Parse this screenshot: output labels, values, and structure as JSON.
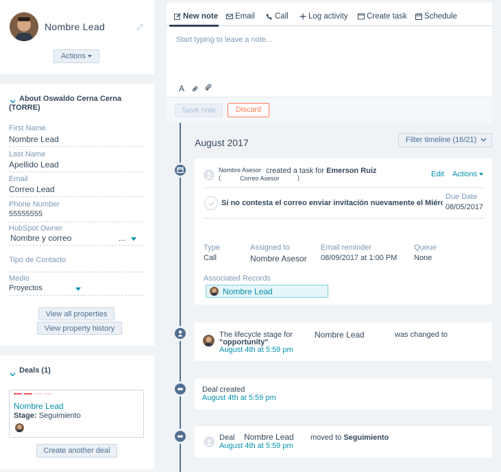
{
  "profile": {
    "name": "Nombre Lead",
    "actions_label": "Actions"
  },
  "about": {
    "title": "About Oswaldo Cerna Cerna (TORRE)",
    "fields": [
      {
        "label": "First Name",
        "value": "Nombre Lead"
      },
      {
        "label": "Last Name",
        "value": "Apellido Lead"
      },
      {
        "label": "Email",
        "value": "Correo Lead"
      },
      {
        "label": "Phone Number",
        "value": "55555555"
      },
      {
        "label": "HubSpot Owner",
        "value": "Nombre y correo",
        "suffix": "..."
      },
      {
        "label": "Tipo de Contacto",
        "value": ""
      },
      {
        "label": "Medio",
        "value": "Proyectos"
      }
    ],
    "view_all_label": "View all properties",
    "view_history_label": "View property history"
  },
  "deals": {
    "title": "Deals (1)",
    "deal_name": "Nombre Lead",
    "stage_label": "Stage:",
    "stage_value": "Seguimiento",
    "create_label": "Create another deal"
  },
  "composer": {
    "tabs": [
      "New note",
      "Email",
      "Call",
      "Log activity",
      "Create task",
      "Schedule"
    ],
    "placeholder": "Start typing to leave a note...",
    "save_label": "Save note",
    "discard_label": "Discard"
  },
  "timeline": {
    "month": "August 2017",
    "filter_label": "Filter timeline (16/21)",
    "task": {
      "actor": "Nombre Asesor",
      "actor_email": "Correo Asesor",
      "paren_open": "(",
      "paren_close": ")",
      "action": "created a task for",
      "target": "Emerson Ruiz",
      "edit_label": "Edit",
      "actions_label": "Actions",
      "task_title": "Si no contesta el correo enviar invitación nuevamente el Miérc...",
      "due_label": "Due Date",
      "due_value": "08/05/2017",
      "type_label": "Type",
      "type_value": "Call",
      "assigned_label": "Assigned to",
      "assigned_value": "Nombre Asesor",
      "reminder_label": "Email reminder",
      "reminder_value": "08/09/2017 at 1:00 PM",
      "queue_label": "Queue",
      "queue_value": "None",
      "assoc_label": "Associated Records",
      "assoc_value": "Nombre Lead"
    },
    "lifecycle": {
      "text1": "The lifecycle stage for",
      "name": "Nombre Lead",
      "text2": "was changed to",
      "stage": "\"opportunity\"",
      "time": "August 4th at 5:59 pm"
    },
    "deal_created": {
      "text": "Deal created",
      "time": "August 4th at 5:59 pm"
    },
    "deal_moved": {
      "prefix": "Deal",
      "name": "Nombre Lead",
      "moved": "moved to",
      "stage": "Seguimiento",
      "time": "August 4th at 5:59 pm"
    }
  }
}
